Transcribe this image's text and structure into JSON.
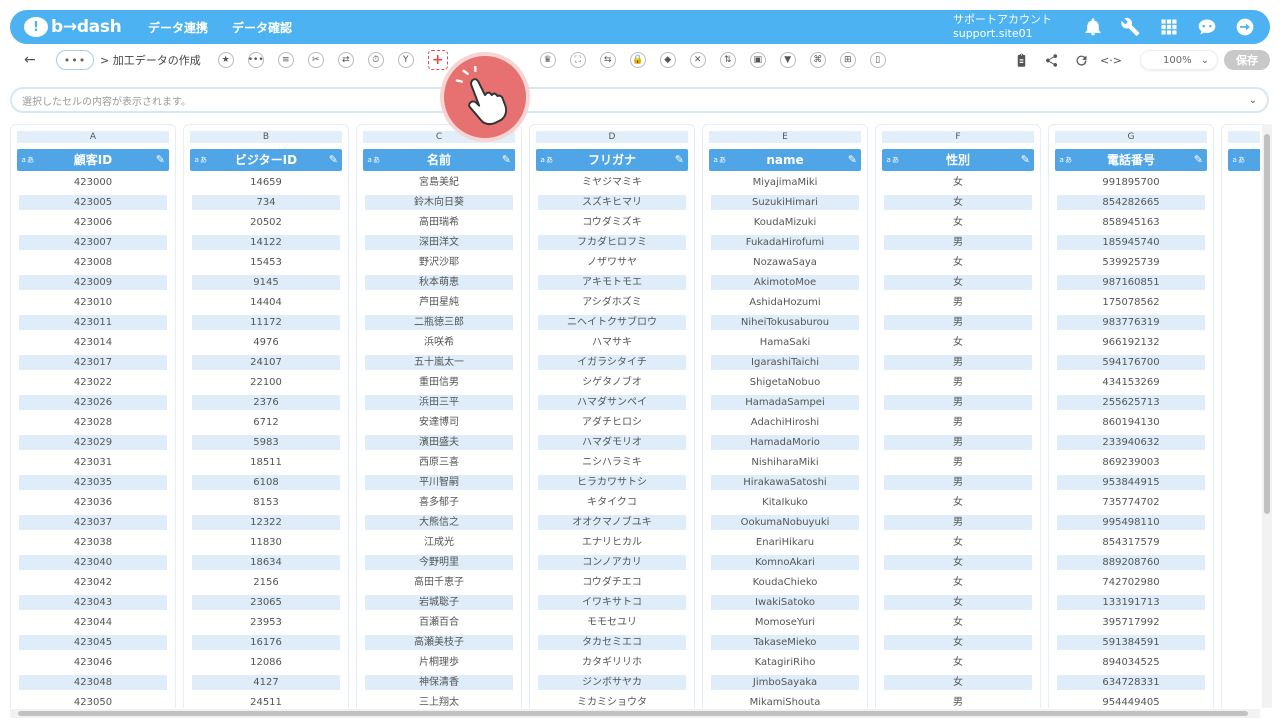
{
  "app": {
    "logo_mark": "!",
    "logo_text": "b→dash",
    "nav": [
      "データ連携",
      "データ確認"
    ],
    "account_line1": "サポートアカウント",
    "account_line2": "support.site01",
    "top_icons": [
      "bell-icon",
      "wrench-icon",
      "grid-icon",
      "chat-bot-icon",
      "logout-icon"
    ]
  },
  "toolbar": {
    "back": "←",
    "more": "•••",
    "breadcrumb": "> 加工データの作成",
    "tools": [
      "★",
      "•••",
      "≡",
      "✂",
      "⇄",
      "⏱",
      "Y",
      "+",
      "",
      "",
      "♛",
      "⛶",
      "⇆",
      "🔒",
      "◆",
      "✕",
      "⇅",
      "▣",
      "▼",
      "⌘",
      "⊞",
      "▯"
    ],
    "zoom": "100%",
    "zoom_chevron": "⌄",
    "save": "保存"
  },
  "cellbar": {
    "placeholder": "選択したセルの内容が表示されます。",
    "chevron": "⌄"
  },
  "type_tag": "ａあ",
  "edit_glyph": "✎",
  "columns": [
    {
      "letter": "A",
      "header": "顧客ID",
      "values": [
        "423000",
        "423005",
        "423006",
        "423007",
        "423008",
        "423009",
        "423010",
        "423011",
        "423014",
        "423017",
        "423022",
        "423026",
        "423028",
        "423029",
        "423031",
        "423035",
        "423036",
        "423037",
        "423038",
        "423040",
        "423042",
        "423043",
        "423044",
        "423045",
        "423046",
        "423048",
        "423050"
      ]
    },
    {
      "letter": "B",
      "header": "ビジターID",
      "values": [
        "14659",
        "734",
        "20502",
        "14122",
        "15453",
        "9145",
        "14404",
        "11172",
        "4976",
        "24107",
        "22100",
        "2376",
        "6712",
        "5983",
        "18511",
        "6108",
        "8153",
        "12322",
        "11830",
        "18634",
        "2156",
        "23065",
        "23953",
        "16176",
        "12086",
        "4127",
        "24511"
      ]
    },
    {
      "letter": "C",
      "header": "名前",
      "values": [
        "宮島美紀",
        "鈴木向日葵",
        "高田瑞希",
        "深田洋文",
        "野沢沙耶",
        "秋本萌恵",
        "芦田星純",
        "二瓶徳三郎",
        "浜咲希",
        "五十嵐太一",
        "重田信男",
        "浜田三平",
        "安達博司",
        "濱田盛夫",
        "西原三喜",
        "平川智嗣",
        "喜多郁子",
        "大熊信之",
        "江成光",
        "今野明里",
        "高田千恵子",
        "岩城聡子",
        "百瀬百合",
        "高瀬美枝子",
        "片桐理歩",
        "神保清香",
        "三上翔太"
      ]
    },
    {
      "letter": "D",
      "header": "フリガナ",
      "values": [
        "ミヤジマミキ",
        "スズキヒマリ",
        "コウダミズキ",
        "フカダヒロフミ",
        "ノザワサヤ",
        "アキモトモエ",
        "アシダホズミ",
        "ニヘイトクサブロウ",
        "ハマサキ",
        "イガラシタイチ",
        "シゲタノブオ",
        "ハマダサンペイ",
        "アダチヒロシ",
        "ハマダモリオ",
        "ニシハラミキ",
        "ヒラカワサトシ",
        "キタイクコ",
        "オオクマノブユキ",
        "エナリヒカル",
        "コンノアカリ",
        "コウダチエコ",
        "イワキサトコ",
        "モモセユリ",
        "タカセミエコ",
        "カタギリリホ",
        "ジンボサヤカ",
        "ミカミショウタ"
      ]
    },
    {
      "letter": "E",
      "header": "name",
      "values": [
        "MiyajimaMiki",
        "SuzukiHimari",
        "KoudaMizuki",
        "FukadaHirofumi",
        "NozawaSaya",
        "AkimotoMoe",
        "AshidaHozumi",
        "NiheiTokusaburou",
        "HamaSaki",
        "IgarashiTaichi",
        "ShigetaNobuo",
        "HamadaSampei",
        "AdachiHiroshi",
        "HamadaMorio",
        "NishiharaMiki",
        "HirakawaSatoshi",
        "KitaIkuko",
        "OokumaNobuyuki",
        "EnariHikaru",
        "KomnoAkari",
        "KoudaChieko",
        "IwakiSatoko",
        "MomoseYuri",
        "TakaseMieko",
        "KatagiriRiho",
        "JimboSayaka",
        "MikamiShouta"
      ]
    },
    {
      "letter": "F",
      "header": "性別",
      "values": [
        "女",
        "女",
        "女",
        "男",
        "女",
        "女",
        "男",
        "男",
        "女",
        "男",
        "男",
        "男",
        "男",
        "男",
        "男",
        "男",
        "女",
        "男",
        "女",
        "女",
        "女",
        "女",
        "女",
        "女",
        "女",
        "女",
        "男"
      ]
    },
    {
      "letter": "G",
      "header": "電話番号",
      "values": [
        "991895700",
        "854282665",
        "858945163",
        "185945740",
        "539925739",
        "987160851",
        "175078562",
        "983776319",
        "966192132",
        "594176700",
        "434153269",
        "255625713",
        "860194130",
        "233940632",
        "869239003",
        "953844915",
        "735774702",
        "995498110",
        "854317579",
        "889208760",
        "742702980",
        "133191713",
        "395717992",
        "591384591",
        "894034525",
        "634728331",
        "954449405"
      ]
    }
  ]
}
